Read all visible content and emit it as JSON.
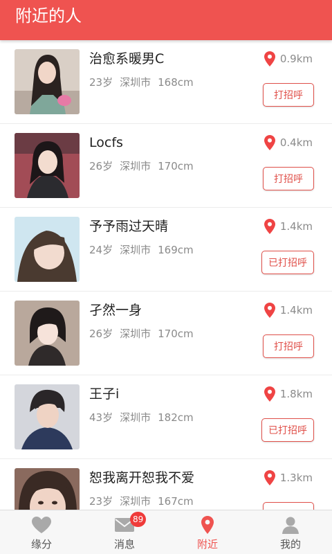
{
  "header": {
    "title": "附近的人"
  },
  "people": [
    {
      "name": "治愈系暖男C",
      "age": "23岁",
      "city": "深圳市",
      "height": "168cm",
      "distance": "0.9km",
      "action": "打招呼"
    },
    {
      "name": "Locfs",
      "age": "26岁",
      "city": "深圳市",
      "height": "170cm",
      "distance": "0.4km",
      "action": "打招呼"
    },
    {
      "name": "予予雨过天晴",
      "age": "24岁",
      "city": "深圳市",
      "height": "169cm",
      "distance": "1.4km",
      "action": "已打招呼"
    },
    {
      "name": "孑然一身",
      "age": "26岁",
      "city": "深圳市",
      "height": "170cm",
      "distance": "1.4km",
      "action": "打招呼"
    },
    {
      "name": "王子i",
      "age": "43岁",
      "city": "深圳市",
      "height": "182cm",
      "distance": "1.8km",
      "action": "已打招呼"
    },
    {
      "name": "恕我离开恕我不爱",
      "age": "23岁",
      "city": "深圳市",
      "height": "167cm",
      "distance": "1.3km",
      "action": ""
    }
  ],
  "tabs": [
    {
      "label": "缘分",
      "icon": "heart-icon"
    },
    {
      "label": "消息",
      "icon": "mail-icon",
      "badge": "89"
    },
    {
      "label": "附近",
      "icon": "location-pin-icon"
    },
    {
      "label": "我的",
      "icon": "person-icon"
    }
  ],
  "colors": {
    "accent": "#ef5350",
    "button_border": "#e0504a",
    "badge": "#ef3b3a"
  }
}
